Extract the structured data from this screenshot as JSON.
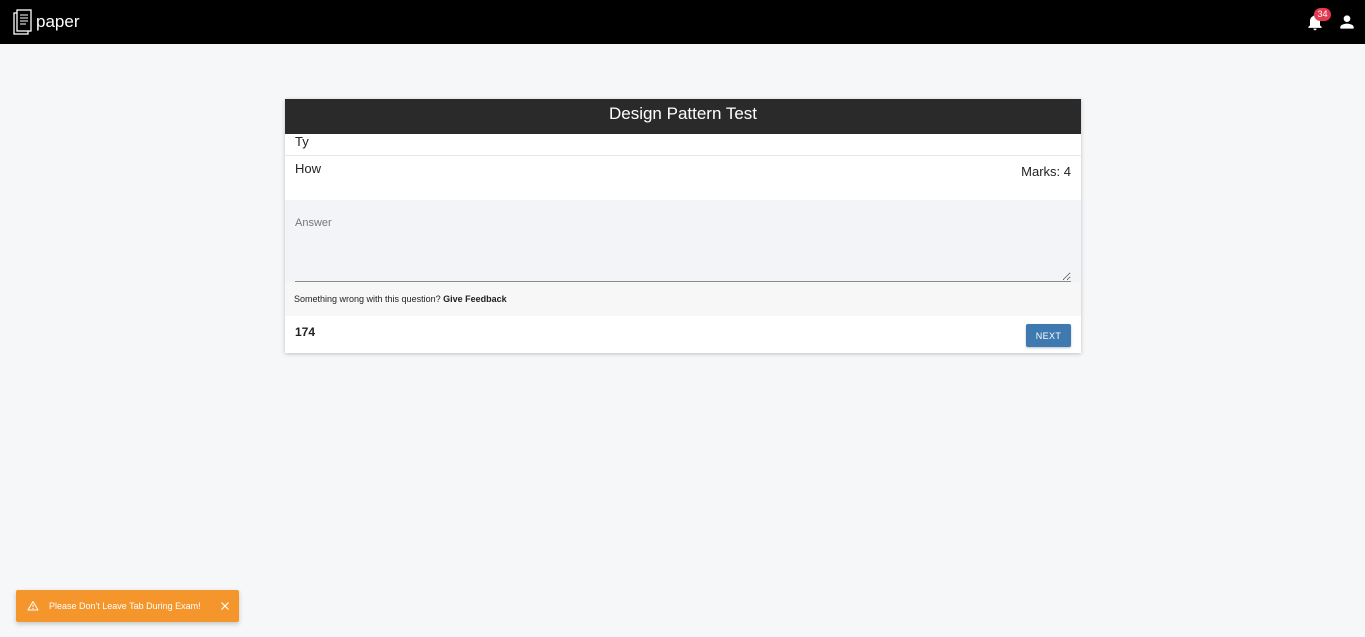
{
  "app": {
    "name": "paper"
  },
  "header": {
    "notification_count": "34"
  },
  "exam": {
    "title": "Design Pattern Test",
    "section_label": "Ty",
    "question_text": "How",
    "marks_text": "Marks: 4",
    "answer_placeholder": "Answer",
    "answer_value": "",
    "feedback_prompt": "Something wrong with this question?",
    "feedback_link": "Give Feedback",
    "timer_value": "174",
    "next_label": "NEXT"
  },
  "toast": {
    "message": "Please Don't Leave Tab During Exam!"
  },
  "colors": {
    "topbar": "#000000",
    "card_header": "#2a2a2a",
    "next_button": "#3e79b0",
    "toast": "#f4962b",
    "badge": "#e53950"
  },
  "icons": {
    "logo": "paper-logo-icon",
    "notifications": "bell-icon",
    "account": "user-icon",
    "toast_warning": "warning-icon",
    "toast_close": "close-icon"
  }
}
